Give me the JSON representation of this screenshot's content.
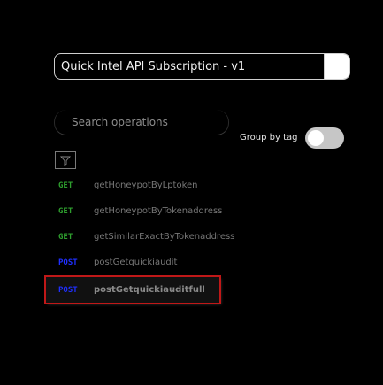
{
  "api_select": {
    "label": "Quick Intel API Subscription - v1"
  },
  "search": {
    "placeholder": "Search operations"
  },
  "group_by_tag": {
    "label": "Group by tag",
    "enabled": false
  },
  "filter": {
    "icon": "filter-icon"
  },
  "operations": [
    {
      "method": "GET",
      "name": "getHoneypotByLptoken"
    },
    {
      "method": "GET",
      "name": "getHoneypotByTokenaddress"
    },
    {
      "method": "GET",
      "name": "getSimilarExactByTokenaddress"
    },
    {
      "method": "POST",
      "name": "postGetquickiaudit"
    },
    {
      "method": "POST",
      "name": "postGetquickiauditfull",
      "selected": true
    }
  ],
  "colors": {
    "get": "#2e9e2e",
    "post": "#1f2fff",
    "selection_outline": "#c01818"
  }
}
